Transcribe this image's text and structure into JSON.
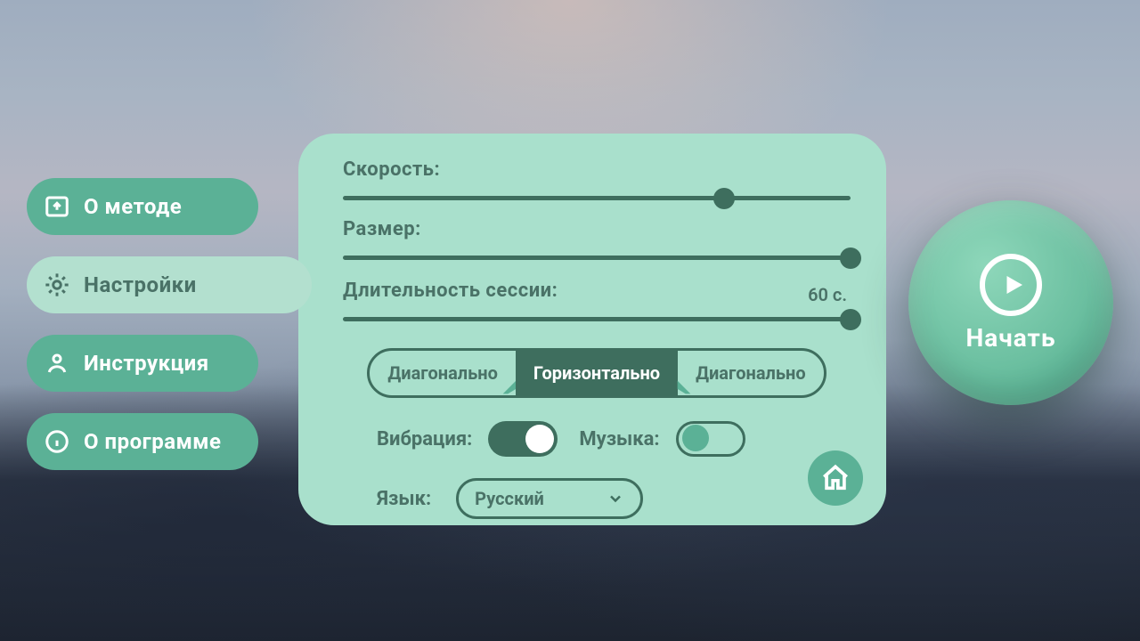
{
  "menu": {
    "about_method": "О методе",
    "settings": "Настройки",
    "instructions": "Инструкция",
    "about_program": "О программе"
  },
  "panel": {
    "speed_label": "Скорость:",
    "size_label": "Размер:",
    "duration_label": "Длительность сессии:",
    "duration_value": "60 с.",
    "direction": {
      "left": "Диагонально",
      "center": "Горизонтально",
      "right": "Диагонально"
    },
    "vibration_label": "Вибрация:",
    "music_label": "Музыка:",
    "language_label": "Язык:",
    "language_value": "Русский"
  },
  "start_label": "Начать",
  "sliders": {
    "speed_pct": 75,
    "size_pct": 100,
    "duration_pct": 100
  },
  "toggles": {
    "vibration": true,
    "music": false
  },
  "colors": {
    "accent": "#5bb196",
    "accent_dark": "#3e6e5e",
    "panel_bg": "#a9e0cc",
    "text": "#4a7267"
  }
}
